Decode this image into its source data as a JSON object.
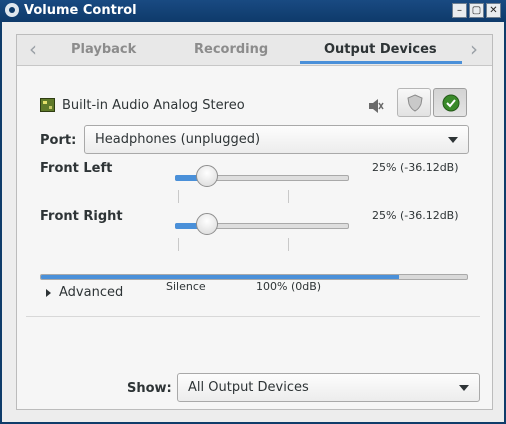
{
  "window": {
    "title": "Volume Control",
    "buttons": [
      "minimize",
      "maximize",
      "close"
    ]
  },
  "tabs": [
    {
      "label": "Playback",
      "active": false
    },
    {
      "label": "Recording",
      "active": false
    },
    {
      "label": "Output Devices",
      "active": true
    }
  ],
  "device": {
    "name": "Built-in Audio Analog Stereo",
    "port_label": "Port:",
    "port_value": "Headphones (unplugged)",
    "channels": [
      {
        "name": "Front Left",
        "volume_text": "25% (-36.12dB)",
        "level_percent": 25
      },
      {
        "name": "Front Right",
        "volume_text": "25% (-36.12dB)",
        "level_percent": 25
      }
    ],
    "scale_marks": {
      "silence": "Silence",
      "full": "100% (0dB)"
    },
    "peak_level_percent": 84,
    "advanced_label": "Advanced",
    "muted": false,
    "default_device": true
  },
  "footer": {
    "show_label": "Show:",
    "show_value": "All Output Devices"
  },
  "colors": {
    "accent": "#4a90d9",
    "titlebar": "#0e3a6a",
    "default_check": "#3a8a2a"
  }
}
